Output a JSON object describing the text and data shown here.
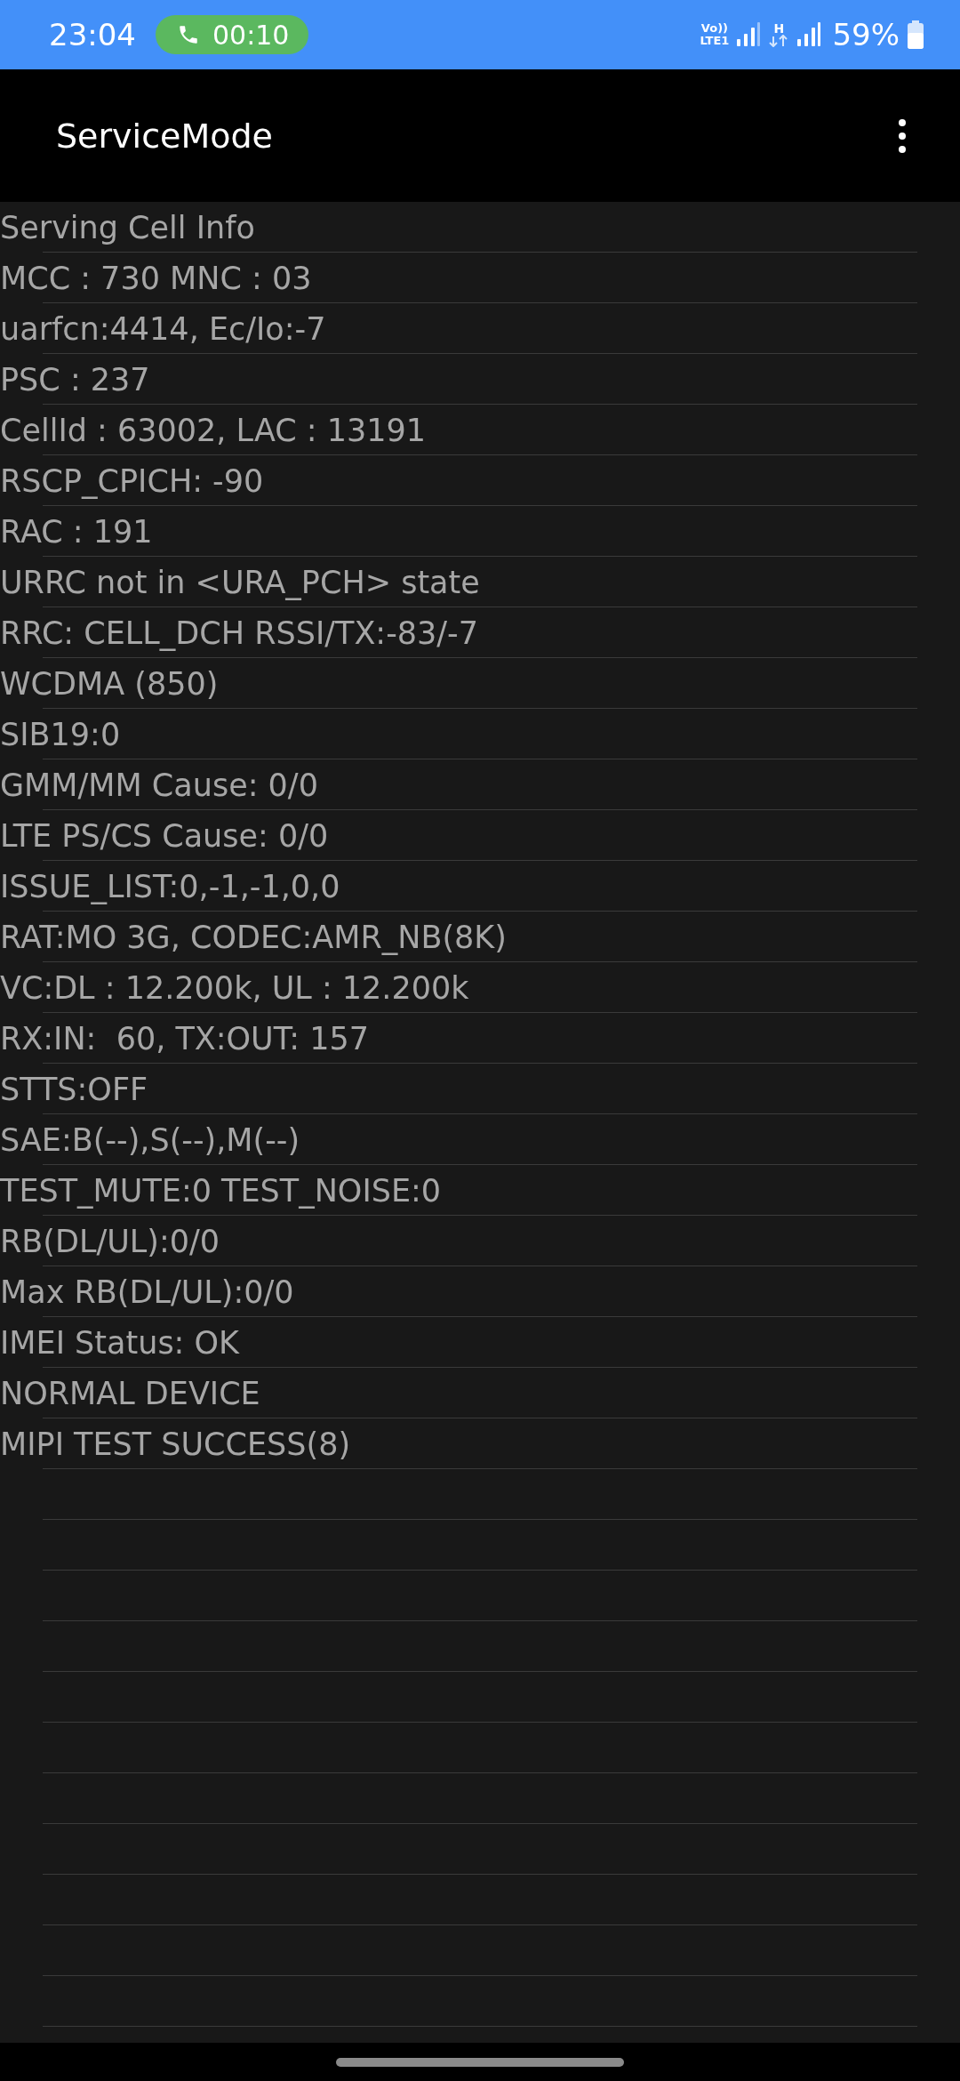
{
  "status_bar": {
    "time": "23:04",
    "call_timer": "00:10",
    "volte_top": "Vo))",
    "volte_bottom": "LTE1",
    "data_type": "H",
    "battery": "59%"
  },
  "app_bar": {
    "title": "ServiceMode"
  },
  "info_lines": [
    "Serving Cell Info",
    "MCC : 730 MNC : 03",
    "uarfcn:4414, Ec/Io:-7",
    "PSC : 237",
    "CellId : 63002, LAC : 13191",
    "RSCP_CPICH: -90",
    "RAC : 191",
    "URRC not in <URA_PCH> state",
    "RRC: CELL_DCH RSSI/TX:-83/-7",
    "WCDMA (850)",
    "SIB19:0",
    "GMM/MM Cause: 0/0",
    "LTE PS/CS Cause: 0/0",
    "ISSUE_LIST:0,-1,-1,0,0",
    "RAT:MO 3G, CODEC:AMR_NB(8K)",
    "VC:DL : 12.200k, UL : 12.200k",
    "RX:IN:  60, TX:OUT: 157",
    "STTS:OFF",
    "SAE:B(--),S(--),M(--)",
    "TEST_MUTE:0 TEST_NOISE:0",
    "RB(DL/UL):0/0",
    "Max RB(DL/UL):0/0",
    "IMEI Status: OK",
    "NORMAL DEVICE",
    "MIPI TEST SUCCESS(8)"
  ]
}
